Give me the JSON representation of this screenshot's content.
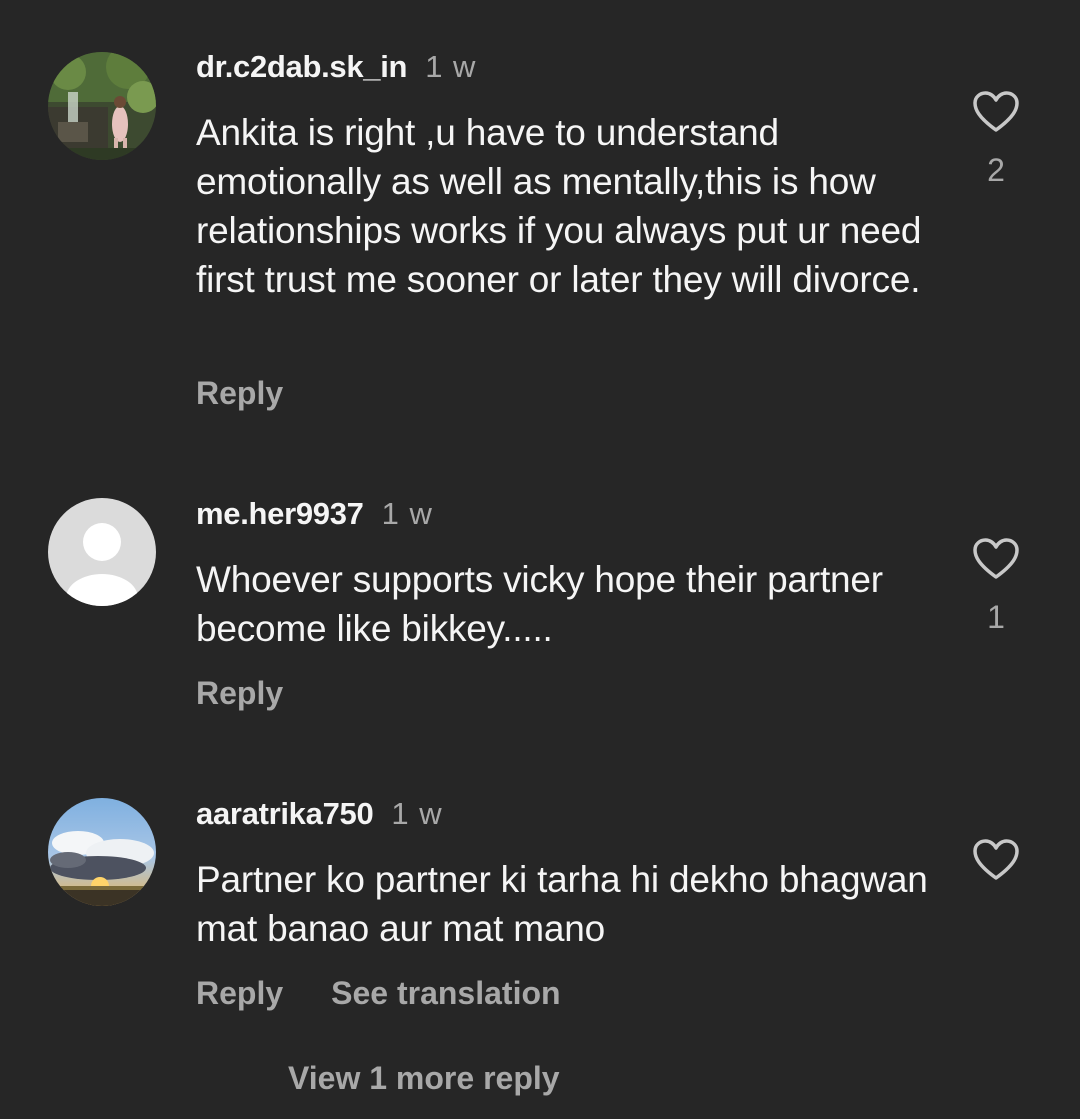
{
  "comments": [
    {
      "username": "dr.c2dab.sk_in",
      "time": "1 w",
      "text": "Ankita is right ,u have to understand emotionally as well as mentally,this is how relationships works if you always put ur need first trust me sooner or later they will divorce.",
      "likes": "2",
      "reply_label": "Reply",
      "avatar": "photo-person-waterfall"
    },
    {
      "username": "me.her9937",
      "time": "1 w",
      "text": "Whoever supports vicky hope their partner become like bikkey.....",
      "likes": "1",
      "reply_label": "Reply",
      "avatar": "default-profile-placeholder"
    },
    {
      "username": "aaratrika750",
      "time": "1 w",
      "text": "Partner ko partner ki tarha hi dekho bhagwan mat banao aur mat mano",
      "likes": "",
      "reply_label": "Reply",
      "see_translation_label": "See translation",
      "avatar": "photo-sunset-sky"
    }
  ],
  "view_more_replies": "View 1 more reply",
  "icons": {
    "like": "heart-outline-icon"
  },
  "colors": {
    "background": "#262626",
    "primary_text": "#f5f5f5",
    "secondary_text": "#a8a8a8"
  }
}
